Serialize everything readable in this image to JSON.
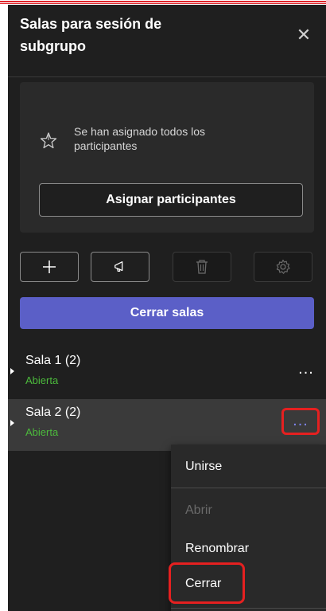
{
  "panel": {
    "title": "Salas para sesión de subgrupo",
    "close_icon": "close-icon"
  },
  "assign_card": {
    "message": "Se han asignado todos los participantes",
    "icon": "star-icon",
    "button_label": "Asignar participantes"
  },
  "toolbar": {
    "buttons": [
      {
        "name": "add-room",
        "icon": "plus-icon",
        "enabled": true
      },
      {
        "name": "announcement",
        "icon": "megaphone-icon",
        "enabled": true
      },
      {
        "name": "delete",
        "icon": "trash-icon",
        "enabled": false
      },
      {
        "name": "settings",
        "icon": "gear-icon",
        "enabled": false
      }
    ]
  },
  "close_rooms_label": "Cerrar salas",
  "rooms": [
    {
      "name": "Sala 1",
      "count": "(2)",
      "status": "Abierta",
      "more_label": "...",
      "selected": false
    },
    {
      "name": "Sala 2",
      "count": "(2)",
      "status": "Abierta",
      "more_label": "...",
      "selected": true
    }
  ],
  "context_menu": {
    "items": [
      {
        "label": "Unirse",
        "enabled": true
      },
      {
        "label": "Abrir",
        "enabled": false
      },
      {
        "label": "Renombrar",
        "enabled": true
      },
      {
        "label": "Cerrar",
        "enabled": true
      }
    ]
  },
  "colors": {
    "accent": "#5b5fc7",
    "status_open": "#4cba3c",
    "highlight": "#e52020",
    "panel_bg": "#1f1f1f"
  }
}
